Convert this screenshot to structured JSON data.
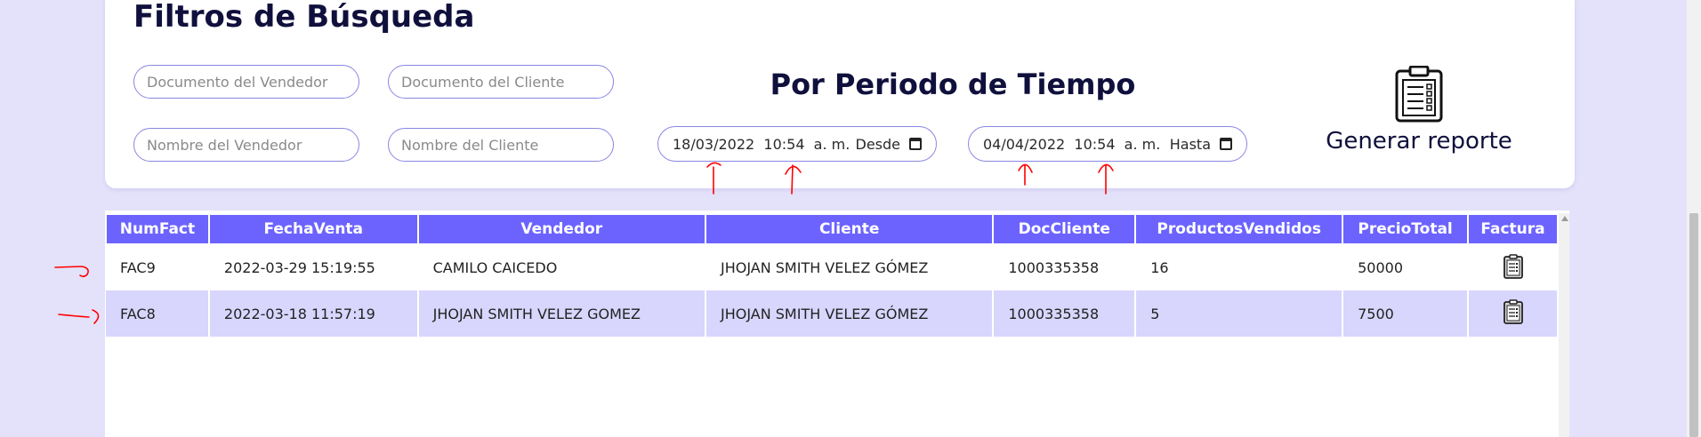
{
  "filters": {
    "title": "Filtros de Búsqueda",
    "vendor_doc_placeholder": "Documento del Vendedor",
    "client_doc_placeholder": "Documento del Cliente",
    "vendor_name_placeholder": "Nombre del Vendedor",
    "client_name_placeholder": "Nombre del Cliente"
  },
  "period": {
    "title": "Por Periodo de Tiempo",
    "from_value": "18/03/2022  10:54  a. m.",
    "from_label": "Desde",
    "to_value": "04/04/2022  10:54  a. m.",
    "to_label": "Hasta"
  },
  "report": {
    "label": "Generar reporte",
    "icon": "clipboard-icon"
  },
  "table": {
    "headers": [
      "NumFact",
      "FechaVenta",
      "Vendedor",
      "Cliente",
      "DocCliente",
      "ProductosVendidos",
      "PrecioTotal",
      "Factura"
    ],
    "rows": [
      {
        "num": "FAC9",
        "fecha": "2022-03-29 15:19:55",
        "vendedor": "CAMILO CAICEDO",
        "cliente": "JHOJAN SMITH VELEZ GÓMEZ",
        "doc": "1000335358",
        "productos": "16",
        "precio": "50000",
        "icon": "clipboard-icon"
      },
      {
        "num": "FAC8",
        "fecha": "2022-03-18 11:57:19",
        "vendedor": "JHOJAN SMITH VELEZ GOMEZ",
        "cliente": "JHOJAN SMITH VELEZ GÓMEZ",
        "doc": "1000335358",
        "productos": "5",
        "precio": "7500",
        "icon": "clipboard-icon"
      }
    ]
  },
  "colors": {
    "background": "#e4e2fb",
    "header": "#6c63ff",
    "row_alt": "#d8d6fd",
    "title": "#10103d",
    "annotation": "#ff0000"
  }
}
